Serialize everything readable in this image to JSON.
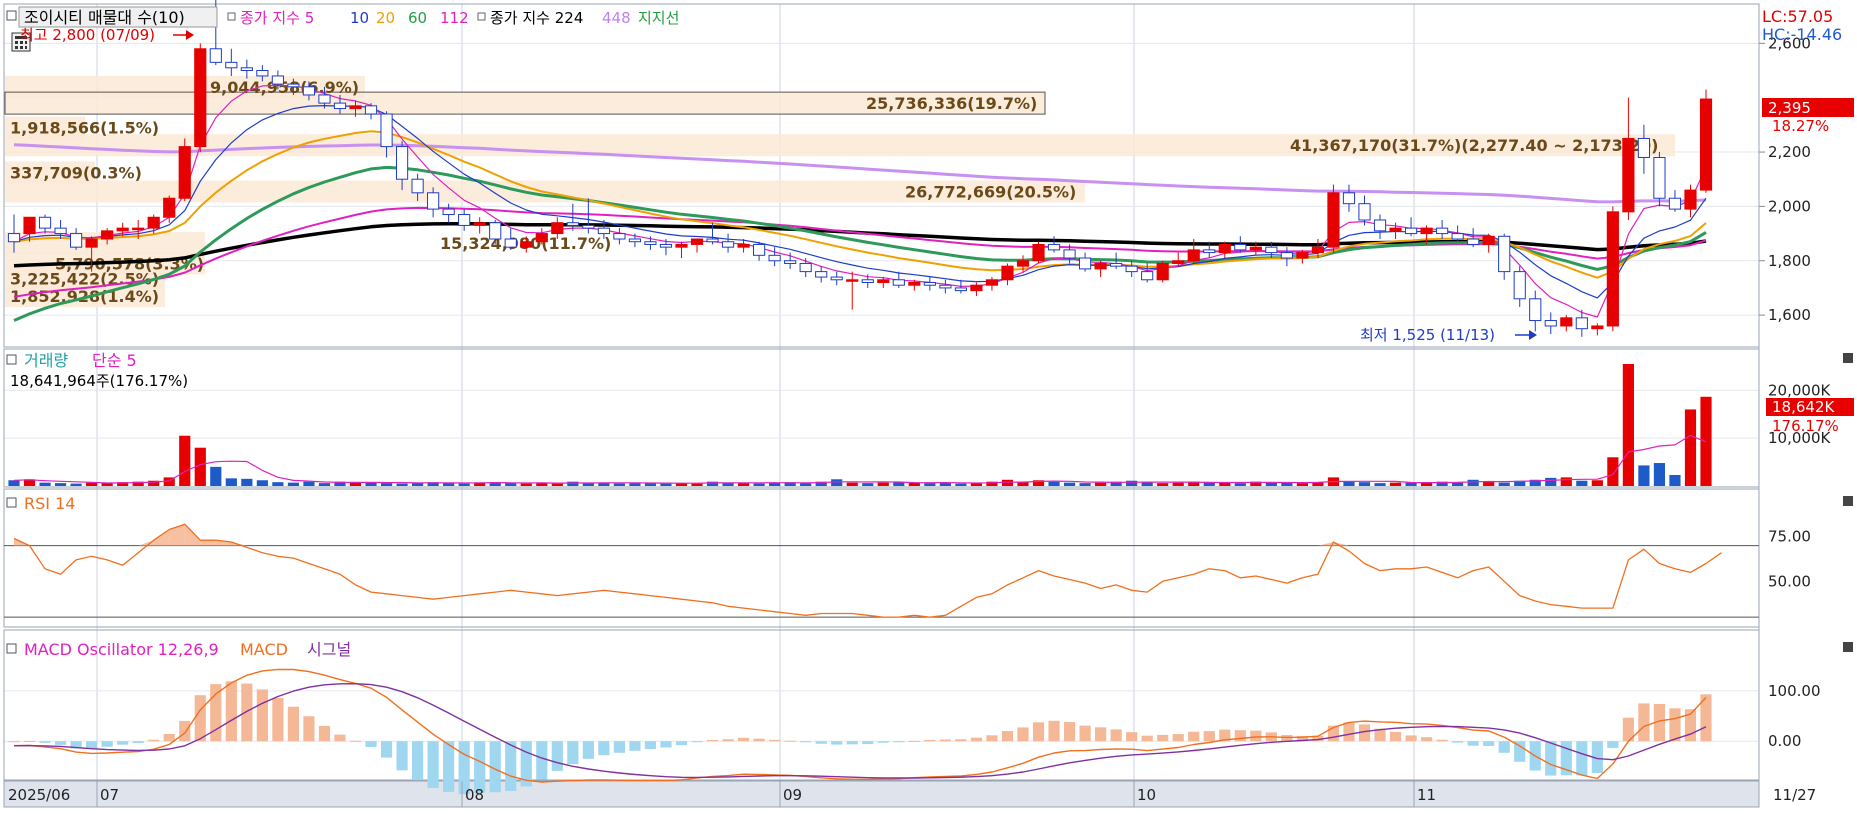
{
  "chart_data": {
    "type": "candlestick",
    "symbol_label": "조이시티 매물대 수(10)",
    "legend_price": [
      {
        "text": "종가 지수 5",
        "color": "#e020c0"
      },
      {
        "text": "10",
        "color": "#1e3cc8"
      },
      {
        "text": "20",
        "color": "#f0a000"
      },
      {
        "text": "60",
        "color": "#20a040"
      },
      {
        "text": "112",
        "color": "#e020c0"
      },
      {
        "text": "종가 지수 224",
        "color": "#000000"
      },
      {
        "text": "448",
        "color": "#c080f0"
      },
      {
        "text": "지지선",
        "color": "#20a040"
      }
    ],
    "lc_label": "LC:57.05",
    "hc_label": "HC:-14.46",
    "price_axis": {
      "ticks": [
        "2,600",
        "2,200",
        "2,000",
        "1,800",
        "1,600"
      ],
      "values": [
        2600,
        2200,
        2000,
        1800,
        1600
      ],
      "range": [
        1490,
        2730
      ]
    },
    "current_price": {
      "label": "2,395",
      "value": 2395,
      "pct": "18.27%"
    },
    "high_annotation": "최고 2,800 (07/09)",
    "low_annotation": "최저 1,525 (11/13)",
    "volume_profile": [
      {
        "label": "9,044,958(6.9%)",
        "price": 2440
      },
      {
        "label": "25,736,336(19.7%)",
        "price": 2380
      },
      {
        "label": "1,918,566(1.5%)",
        "price": 2290
      },
      {
        "label": "41,367,170(31.7%)(2,277.40 ~ 2,173.20)",
        "price": 2225
      },
      {
        "label": "337,709(0.3%)",
        "price": 2125
      },
      {
        "label": "26,772,669(20.5%)",
        "price": 2055
      },
      {
        "label": "15,324,980(11.7%)",
        "price": 1865
      },
      {
        "label": "5,790,578(3.3%)",
        "price": 1790
      },
      {
        "label": "3,225,422(2.5%)",
        "price": 1735
      },
      {
        "label": "1,852,928(1.4%)",
        "price": 1670
      }
    ],
    "candles": [
      [
        1900,
        1970,
        1830,
        1870
      ],
      [
        1900,
        1960,
        1870,
        1960
      ],
      [
        1960,
        1970,
        1900,
        1920
      ],
      [
        1920,
        1950,
        1880,
        1900
      ],
      [
        1900,
        1920,
        1840,
        1850
      ],
      [
        1850,
        1890,
        1760,
        1880
      ],
      [
        1880,
        1920,
        1860,
        1910
      ],
      [
        1910,
        1940,
        1890,
        1920
      ],
      [
        1920,
        1950,
        1880,
        1920
      ],
      [
        1920,
        1970,
        1900,
        1960
      ],
      [
        1960,
        2040,
        1940,
        2030
      ],
      [
        2030,
        2250,
        2020,
        2220
      ],
      [
        2220,
        2600,
        2200,
        2580
      ],
      [
        2580,
        2800,
        2520,
        2530
      ],
      [
        2530,
        2580,
        2480,
        2510
      ],
      [
        2510,
        2540,
        2470,
        2500
      ],
      [
        2500,
        2520,
        2460,
        2480
      ],
      [
        2480,
        2500,
        2430,
        2450
      ],
      [
        2450,
        2470,
        2410,
        2440
      ],
      [
        2440,
        2460,
        2390,
        2410
      ],
      [
        2410,
        2440,
        2360,
        2380
      ],
      [
        2380,
        2410,
        2340,
        2360
      ],
      [
        2360,
        2390,
        2330,
        2370
      ],
      [
        2370,
        2380,
        2320,
        2340
      ],
      [
        2340,
        2350,
        2180,
        2220
      ],
      [
        2220,
        2240,
        2060,
        2100
      ],
      [
        2100,
        2120,
        2020,
        2050
      ],
      [
        2050,
        2070,
        1960,
        1990
      ],
      [
        1990,
        2010,
        1940,
        1970
      ],
      [
        1970,
        1990,
        1910,
        1930
      ],
      [
        1930,
        1960,
        1900,
        1940
      ],
      [
        1940,
        1950,
        1860,
        1880
      ],
      [
        1880,
        1920,
        1840,
        1850
      ],
      [
        1850,
        1890,
        1830,
        1870
      ],
      [
        1870,
        1920,
        1860,
        1900
      ],
      [
        1900,
        1960,
        1880,
        1940
      ],
      [
        1940,
        2010,
        1910,
        1930
      ],
      [
        1930,
        2030,
        1900,
        1920
      ],
      [
        1920,
        1950,
        1880,
        1900
      ],
      [
        1900,
        1920,
        1860,
        1880
      ],
      [
        1880,
        1900,
        1850,
        1870
      ],
      [
        1870,
        1890,
        1840,
        1860
      ],
      [
        1860,
        1880,
        1820,
        1850
      ],
      [
        1850,
        1870,
        1810,
        1860
      ],
      [
        1860,
        1880,
        1830,
        1880
      ],
      [
        1880,
        1940,
        1860,
        1870
      ],
      [
        1870,
        1900,
        1830,
        1850
      ],
      [
        1850,
        1880,
        1830,
        1860
      ],
      [
        1860,
        1870,
        1800,
        1820
      ],
      [
        1820,
        1850,
        1780,
        1800
      ],
      [
        1800,
        1830,
        1770,
        1790
      ],
      [
        1790,
        1810,
        1740,
        1760
      ],
      [
        1760,
        1780,
        1720,
        1740
      ],
      [
        1740,
        1760,
        1710,
        1730
      ],
      [
        1730,
        1760,
        1620,
        1730
      ],
      [
        1730,
        1750,
        1700,
        1720
      ],
      [
        1720,
        1740,
        1700,
        1730
      ],
      [
        1730,
        1760,
        1700,
        1710
      ],
      [
        1710,
        1730,
        1690,
        1720
      ],
      [
        1720,
        1740,
        1690,
        1710
      ],
      [
        1710,
        1730,
        1680,
        1700
      ],
      [
        1700,
        1730,
        1680,
        1690
      ],
      [
        1690,
        1720,
        1670,
        1710
      ],
      [
        1710,
        1740,
        1690,
        1730
      ],
      [
        1730,
        1790,
        1710,
        1780
      ],
      [
        1780,
        1820,
        1760,
        1800
      ],
      [
        1800,
        1870,
        1790,
        1860
      ],
      [
        1860,
        1890,
        1830,
        1840
      ],
      [
        1840,
        1860,
        1790,
        1810
      ],
      [
        1810,
        1830,
        1760,
        1770
      ],
      [
        1770,
        1800,
        1740,
        1790
      ],
      [
        1790,
        1830,
        1770,
        1780
      ],
      [
        1780,
        1800,
        1740,
        1760
      ],
      [
        1760,
        1790,
        1720,
        1730
      ],
      [
        1730,
        1800,
        1720,
        1790
      ],
      [
        1790,
        1830,
        1780,
        1800
      ],
      [
        1800,
        1880,
        1790,
        1840
      ],
      [
        1840,
        1870,
        1810,
        1830
      ],
      [
        1830,
        1870,
        1810,
        1860
      ],
      [
        1860,
        1890,
        1830,
        1840
      ],
      [
        1840,
        1870,
        1820,
        1850
      ],
      [
        1850,
        1870,
        1810,
        1830
      ],
      [
        1830,
        1850,
        1780,
        1810
      ],
      [
        1810,
        1840,
        1790,
        1830
      ],
      [
        1830,
        1880,
        1810,
        1850
      ],
      [
        1850,
        2080,
        1830,
        2050
      ],
      [
        2050,
        2080,
        1980,
        2010
      ],
      [
        2010,
        2040,
        1930,
        1950
      ],
      [
        1950,
        1970,
        1880,
        1910
      ],
      [
        1910,
        1940,
        1880,
        1920
      ],
      [
        1920,
        1960,
        1890,
        1900
      ],
      [
        1900,
        1930,
        1860,
        1920
      ],
      [
        1920,
        1950,
        1880,
        1900
      ],
      [
        1900,
        1930,
        1870,
        1880
      ],
      [
        1880,
        1920,
        1850,
        1860
      ],
      [
        1860,
        1900,
        1830,
        1890
      ],
      [
        1890,
        1900,
        1730,
        1760
      ],
      [
        1760,
        1780,
        1630,
        1660
      ],
      [
        1660,
        1690,
        1540,
        1580
      ],
      [
        1580,
        1610,
        1530,
        1560
      ],
      [
        1560,
        1600,
        1540,
        1590
      ],
      [
        1590,
        1620,
        1520,
        1550
      ],
      [
        1550,
        1570,
        1525,
        1560
      ],
      [
        1560,
        2000,
        1540,
        1980
      ],
      [
        1980,
        2400,
        1950,
        2250
      ],
      [
        2250,
        2300,
        2120,
        2180
      ],
      [
        2180,
        2200,
        2000,
        2030
      ],
      [
        2030,
        2060,
        1980,
        1990
      ],
      [
        1990,
        2080,
        1960,
        2060
      ],
      [
        2060,
        2430,
        2050,
        2395
      ]
    ],
    "volume_panel": {
      "title": "거래량",
      "ma_label": "단순 5",
      "readout": "18,641,964주(176.17%)",
      "axis_ticks": [
        "20,000K",
        "10,000K"
      ],
      "axis_values": [
        20000,
        10000
      ],
      "range": [
        0,
        28000
      ],
      "current": {
        "label": "18,642K",
        "value": 18642,
        "pct": "176.17%"
      },
      "values_k": [
        1200,
        1400,
        700,
        600,
        500,
        700,
        600,
        800,
        900,
        1100,
        1800,
        10500,
        8000,
        4000,
        1600,
        1500,
        1200,
        800,
        700,
        900,
        600,
        900,
        700,
        800,
        600,
        500,
        600,
        800,
        700,
        500,
        700,
        800,
        600,
        500,
        600,
        500,
        900,
        600,
        700,
        500,
        600,
        700,
        500,
        600,
        500,
        900,
        700,
        600,
        500,
        700,
        800,
        600,
        900,
        1400,
        700,
        600,
        700,
        800,
        700,
        600,
        700,
        500,
        600,
        900,
        1300,
        800,
        1200,
        900,
        700,
        600,
        700,
        900,
        1100,
        800,
        600,
        700,
        900,
        800,
        700,
        600,
        900,
        800,
        700,
        600,
        800,
        1800,
        900,
        800,
        600,
        700,
        700,
        800,
        900,
        700,
        1300,
        1000,
        700,
        1100,
        1300,
        1700,
        1800,
        1100,
        1200,
        6000,
        25500,
        4300,
        4800,
        2300,
        16000,
        18642
      ]
    },
    "rsi_panel": {
      "title": "RSI 14",
      "axis_ticks": [
        "75.00",
        "50.00"
      ],
      "axis_values": [
        75,
        50
      ],
      "range": [
        25,
        100
      ],
      "values": [
        74,
        70,
        57,
        54,
        62,
        64,
        62,
        59,
        66,
        73,
        79,
        82,
        73,
        73,
        72,
        69,
        66,
        64,
        63,
        60,
        57,
        54,
        48,
        44,
        43,
        42,
        41,
        40,
        41,
        42,
        43,
        44,
        45,
        44,
        43,
        42,
        43,
        44,
        45,
        44,
        43,
        42,
        41,
        40,
        39,
        38,
        36,
        35,
        34,
        33,
        32,
        31,
        32,
        32,
        32,
        31,
        30,
        30,
        31,
        30,
        31,
        36,
        41,
        43,
        48,
        52,
        56,
        53,
        51,
        49,
        46,
        48,
        45,
        44,
        50,
        52,
        54,
        57,
        56,
        52,
        53,
        51,
        49,
        52,
        54,
        72,
        67,
        60,
        56,
        57,
        57,
        58,
        55,
        52,
        56,
        58,
        50,
        42,
        39,
        37,
        36,
        35,
        35,
        35,
        62,
        68,
        60,
        57,
        55,
        60,
        66
      ]
    },
    "macd_panel": {
      "title": "MACD Oscillator 12,26,9",
      "macd_label": "MACD",
      "signal_label": "시그널",
      "axis_ticks": [
        "100.00",
        "0.00"
      ],
      "axis_values": [
        100,
        0
      ],
      "range": [
        -75,
        215
      ]
    },
    "date_axis": {
      "labels": [
        "2025/06",
        "07",
        "08",
        "09",
        "10",
        "11",
        "11/27"
      ]
    }
  }
}
